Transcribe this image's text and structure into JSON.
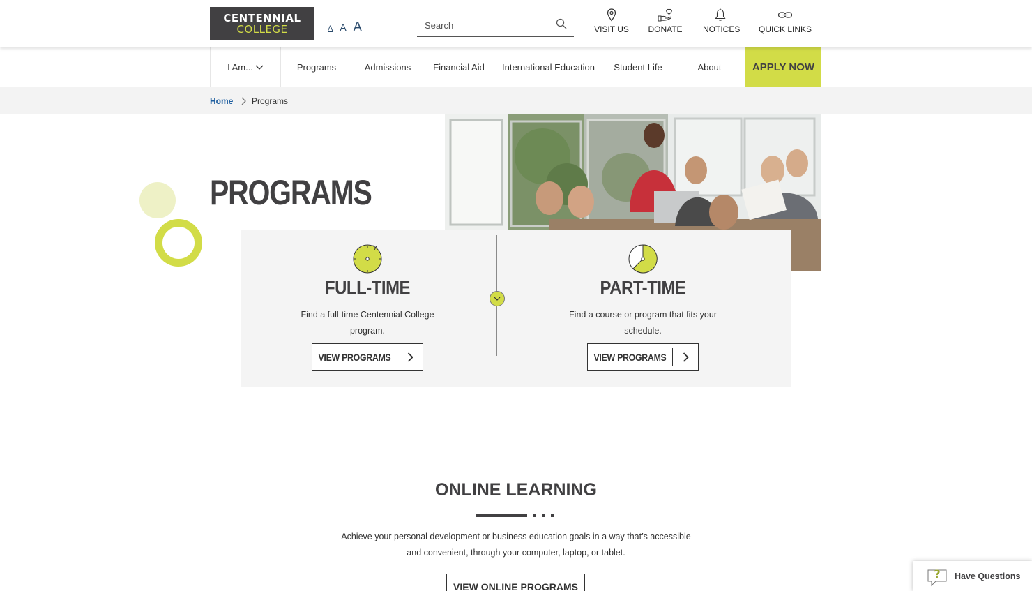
{
  "header": {
    "logo": {
      "line1": "CENTENNIAL",
      "line2": "COLLEGE"
    },
    "font_size_controls": [
      "A",
      "A",
      "A"
    ],
    "search": {
      "placeholder": "Search"
    },
    "top_links": [
      {
        "label": "VISIT US",
        "icon": "map-pin-icon"
      },
      {
        "label": "DONATE",
        "icon": "donate-hand-heart-icon"
      },
      {
        "label": "NOTICES",
        "icon": "bell-icon"
      },
      {
        "label": "QUICK LINKS",
        "icon": "link-icon"
      }
    ]
  },
  "nav": {
    "i_am": "I Am...",
    "items": [
      "Programs",
      "Admissions",
      "Financial Aid",
      "International Education",
      "Student Life",
      "About"
    ],
    "apply": "APPLY NOW"
  },
  "breadcrumb": {
    "home": "Home",
    "current": "Programs"
  },
  "hero": {
    "title": "PROGRAMS"
  },
  "programs": {
    "full_time": {
      "title": "FULL-TIME",
      "description": "Find a full-time Centennial College program.",
      "button": "VIEW PROGRAMS"
    },
    "part_time": {
      "title": "PART-TIME",
      "description": "Find a course or program that fits your schedule.",
      "button": "VIEW PROGRAMS"
    }
  },
  "online_learning": {
    "title": "ONLINE LEARNING",
    "description_line1": "Achieve your personal development or business education goals in a way that’s accessible",
    "description_line2": "and convenient, through your computer, laptop, or tablet.",
    "button": "VIEW ONLINE PROGRAMS"
  },
  "help_widget": {
    "label": "Have Questions"
  },
  "colors": {
    "accent": "#d2dc47",
    "dark": "#414042",
    "link": "#1f5fa0"
  }
}
